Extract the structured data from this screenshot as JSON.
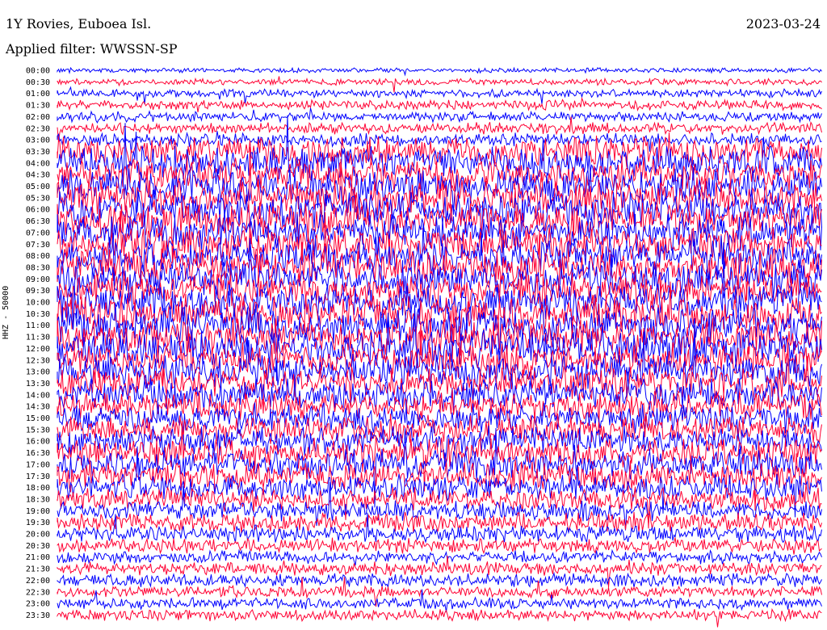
{
  "header": {
    "title": "1Y Rovies, Euboea Isl.",
    "filter": "Applied filter: WWSSN-SP",
    "date": "2023-03-24",
    "channel": "HHZ - 50000"
  },
  "chart_data": {
    "type": "line",
    "title": "1Y Rovies, Euboea Isl.",
    "subtitle": "Applied filter: WWSSN-SP",
    "ylabel": "HHZ - 50000",
    "rows": [
      "00:00",
      "00:30",
      "01:00",
      "01:30",
      "02:00",
      "02:30",
      "03:00",
      "03:30",
      "04:00",
      "04:30",
      "05:00",
      "05:30",
      "06:00",
      "06:30",
      "07:00",
      "07:30",
      "08:00",
      "08:30",
      "09:00",
      "09:30",
      "10:00",
      "10:30",
      "11:00",
      "11:30",
      "12:00",
      "12:30",
      "13:00",
      "13:30",
      "14:00",
      "14:30",
      "15:00",
      "15:30",
      "16:00",
      "16:30",
      "17:00",
      "17:30",
      "18:00",
      "18:30",
      "19:00",
      "19:30",
      "20:00",
      "20:30",
      "21:00",
      "21:30",
      "22:00",
      "22:30",
      "23:00",
      "23:30"
    ],
    "trace_colors": [
      "#0000ff",
      "#ff0033"
    ],
    "relative_amplitude": [
      0.15,
      0.2,
      0.25,
      0.3,
      0.3,
      0.35,
      0.4,
      0.9,
      1.0,
      1.0,
      1.1,
      1.1,
      1.1,
      1.1,
      1.1,
      1.1,
      1.1,
      1.1,
      1.1,
      1.1,
      1.1,
      1.1,
      1.1,
      1.1,
      1.1,
      1.0,
      1.0,
      1.0,
      1.0,
      0.9,
      0.9,
      0.9,
      0.9,
      0.9,
      0.9,
      0.9,
      0.8,
      0.7,
      0.6,
      0.6,
      0.5,
      0.45,
      0.4,
      0.4,
      0.4,
      0.35,
      0.35,
      0.35
    ]
  }
}
